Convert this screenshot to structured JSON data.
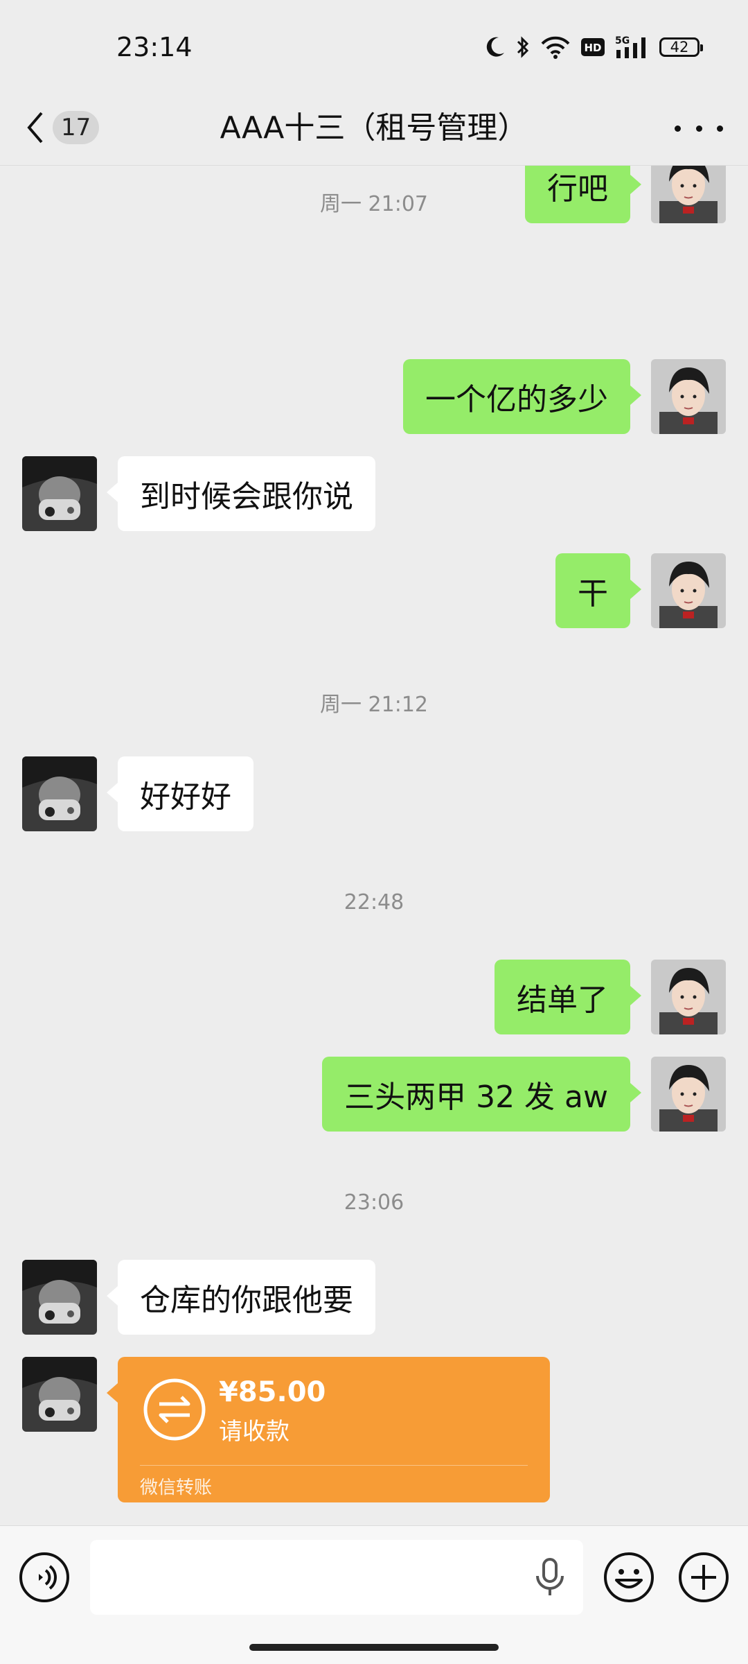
{
  "status_bar": {
    "time": "23:14",
    "battery": "42",
    "network": "5G",
    "hd_label": "HD"
  },
  "nav": {
    "unread_count": "17",
    "title": "AAA十三（租号管理）"
  },
  "messages": [
    {
      "type": "text",
      "side": "right",
      "text": "行吧"
    },
    {
      "type": "time",
      "text": "周一 21:07"
    },
    {
      "type": "text",
      "side": "right",
      "text": "一个亿的多少"
    },
    {
      "type": "text",
      "side": "left",
      "text": "到时候会跟你说"
    },
    {
      "type": "text",
      "side": "right",
      "text": "干"
    },
    {
      "type": "time",
      "text": "周一 21:12"
    },
    {
      "type": "text",
      "side": "left",
      "text": "好好好"
    },
    {
      "type": "time",
      "text": "22:48"
    },
    {
      "type": "text",
      "side": "right",
      "text": "结单了"
    },
    {
      "type": "text",
      "side": "right",
      "text": "三头两甲 32 发 aw"
    },
    {
      "type": "time",
      "text": "23:06"
    },
    {
      "type": "text",
      "side": "left",
      "text": "仓库的你跟他要"
    },
    {
      "type": "transfer",
      "side": "left",
      "amount": "¥85.00",
      "status": "请收款",
      "label": "微信转账"
    }
  ],
  "input": {
    "value": "",
    "placeholder": ""
  },
  "colors": {
    "background": "#ededed",
    "outgoing_bubble": "#95ec69",
    "incoming_bubble": "#ffffff",
    "transfer_card": "#f79c36"
  }
}
